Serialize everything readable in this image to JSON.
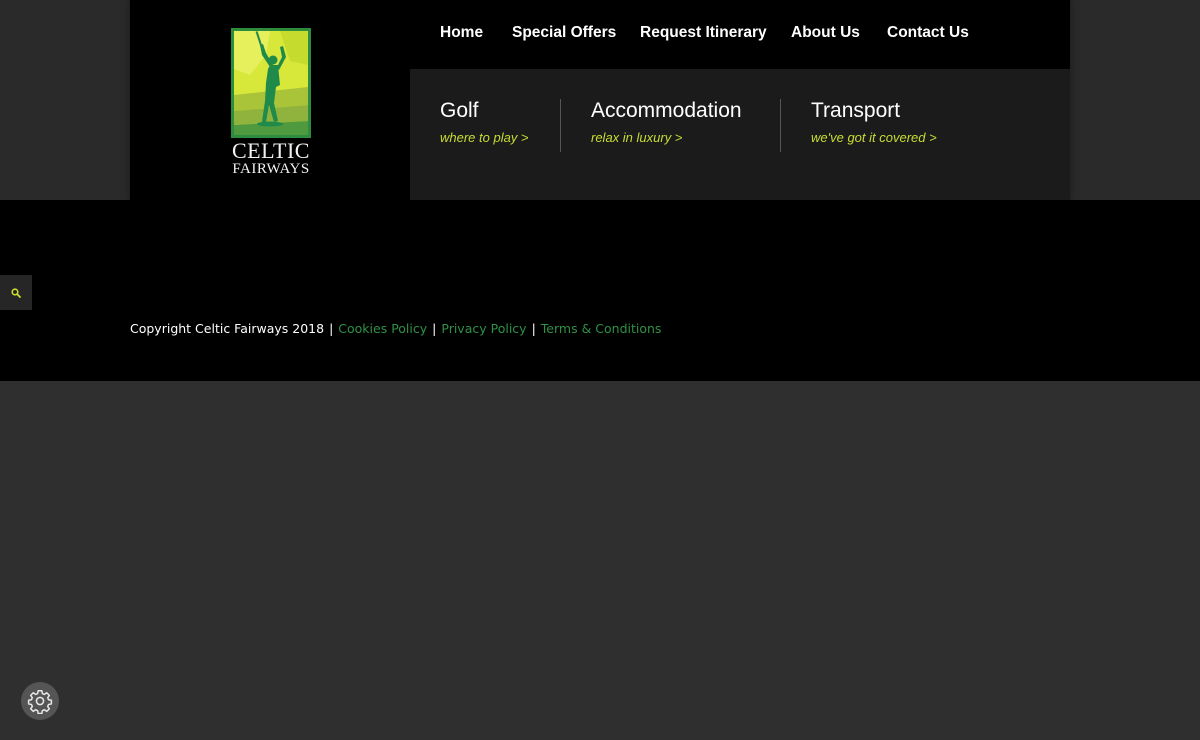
{
  "logo": {
    "line1": "CELTIC",
    "line2": "FAIRWAYS"
  },
  "topnav": [
    {
      "label": "Home"
    },
    {
      "label": "Special Offers"
    },
    {
      "label": "Request Itinerary"
    },
    {
      "label": "About Us"
    },
    {
      "label": "Contact Us"
    }
  ],
  "categories": [
    {
      "title": "Golf",
      "subtitle": "where to play >"
    },
    {
      "title": "Accommodation",
      "subtitle": "relax in luxury >"
    },
    {
      "title": "Transport",
      "subtitle": "we've got it covered >"
    }
  ],
  "footer": {
    "copyright": "Copyright Celtic Fairways 2018",
    "separator": "|",
    "links": [
      {
        "label": "Cookies Policy"
      },
      {
        "label": "Privacy Policy"
      },
      {
        "label": "Terms & Conditions"
      }
    ]
  },
  "icons": {
    "search": "search-icon",
    "settings": "gear-icon"
  },
  "colors": {
    "accent_lime": "#c8dc32",
    "link_green": "#2f9147",
    "page_bg": "#2f2f2f",
    "panel_bg": "#1b1b1b"
  }
}
